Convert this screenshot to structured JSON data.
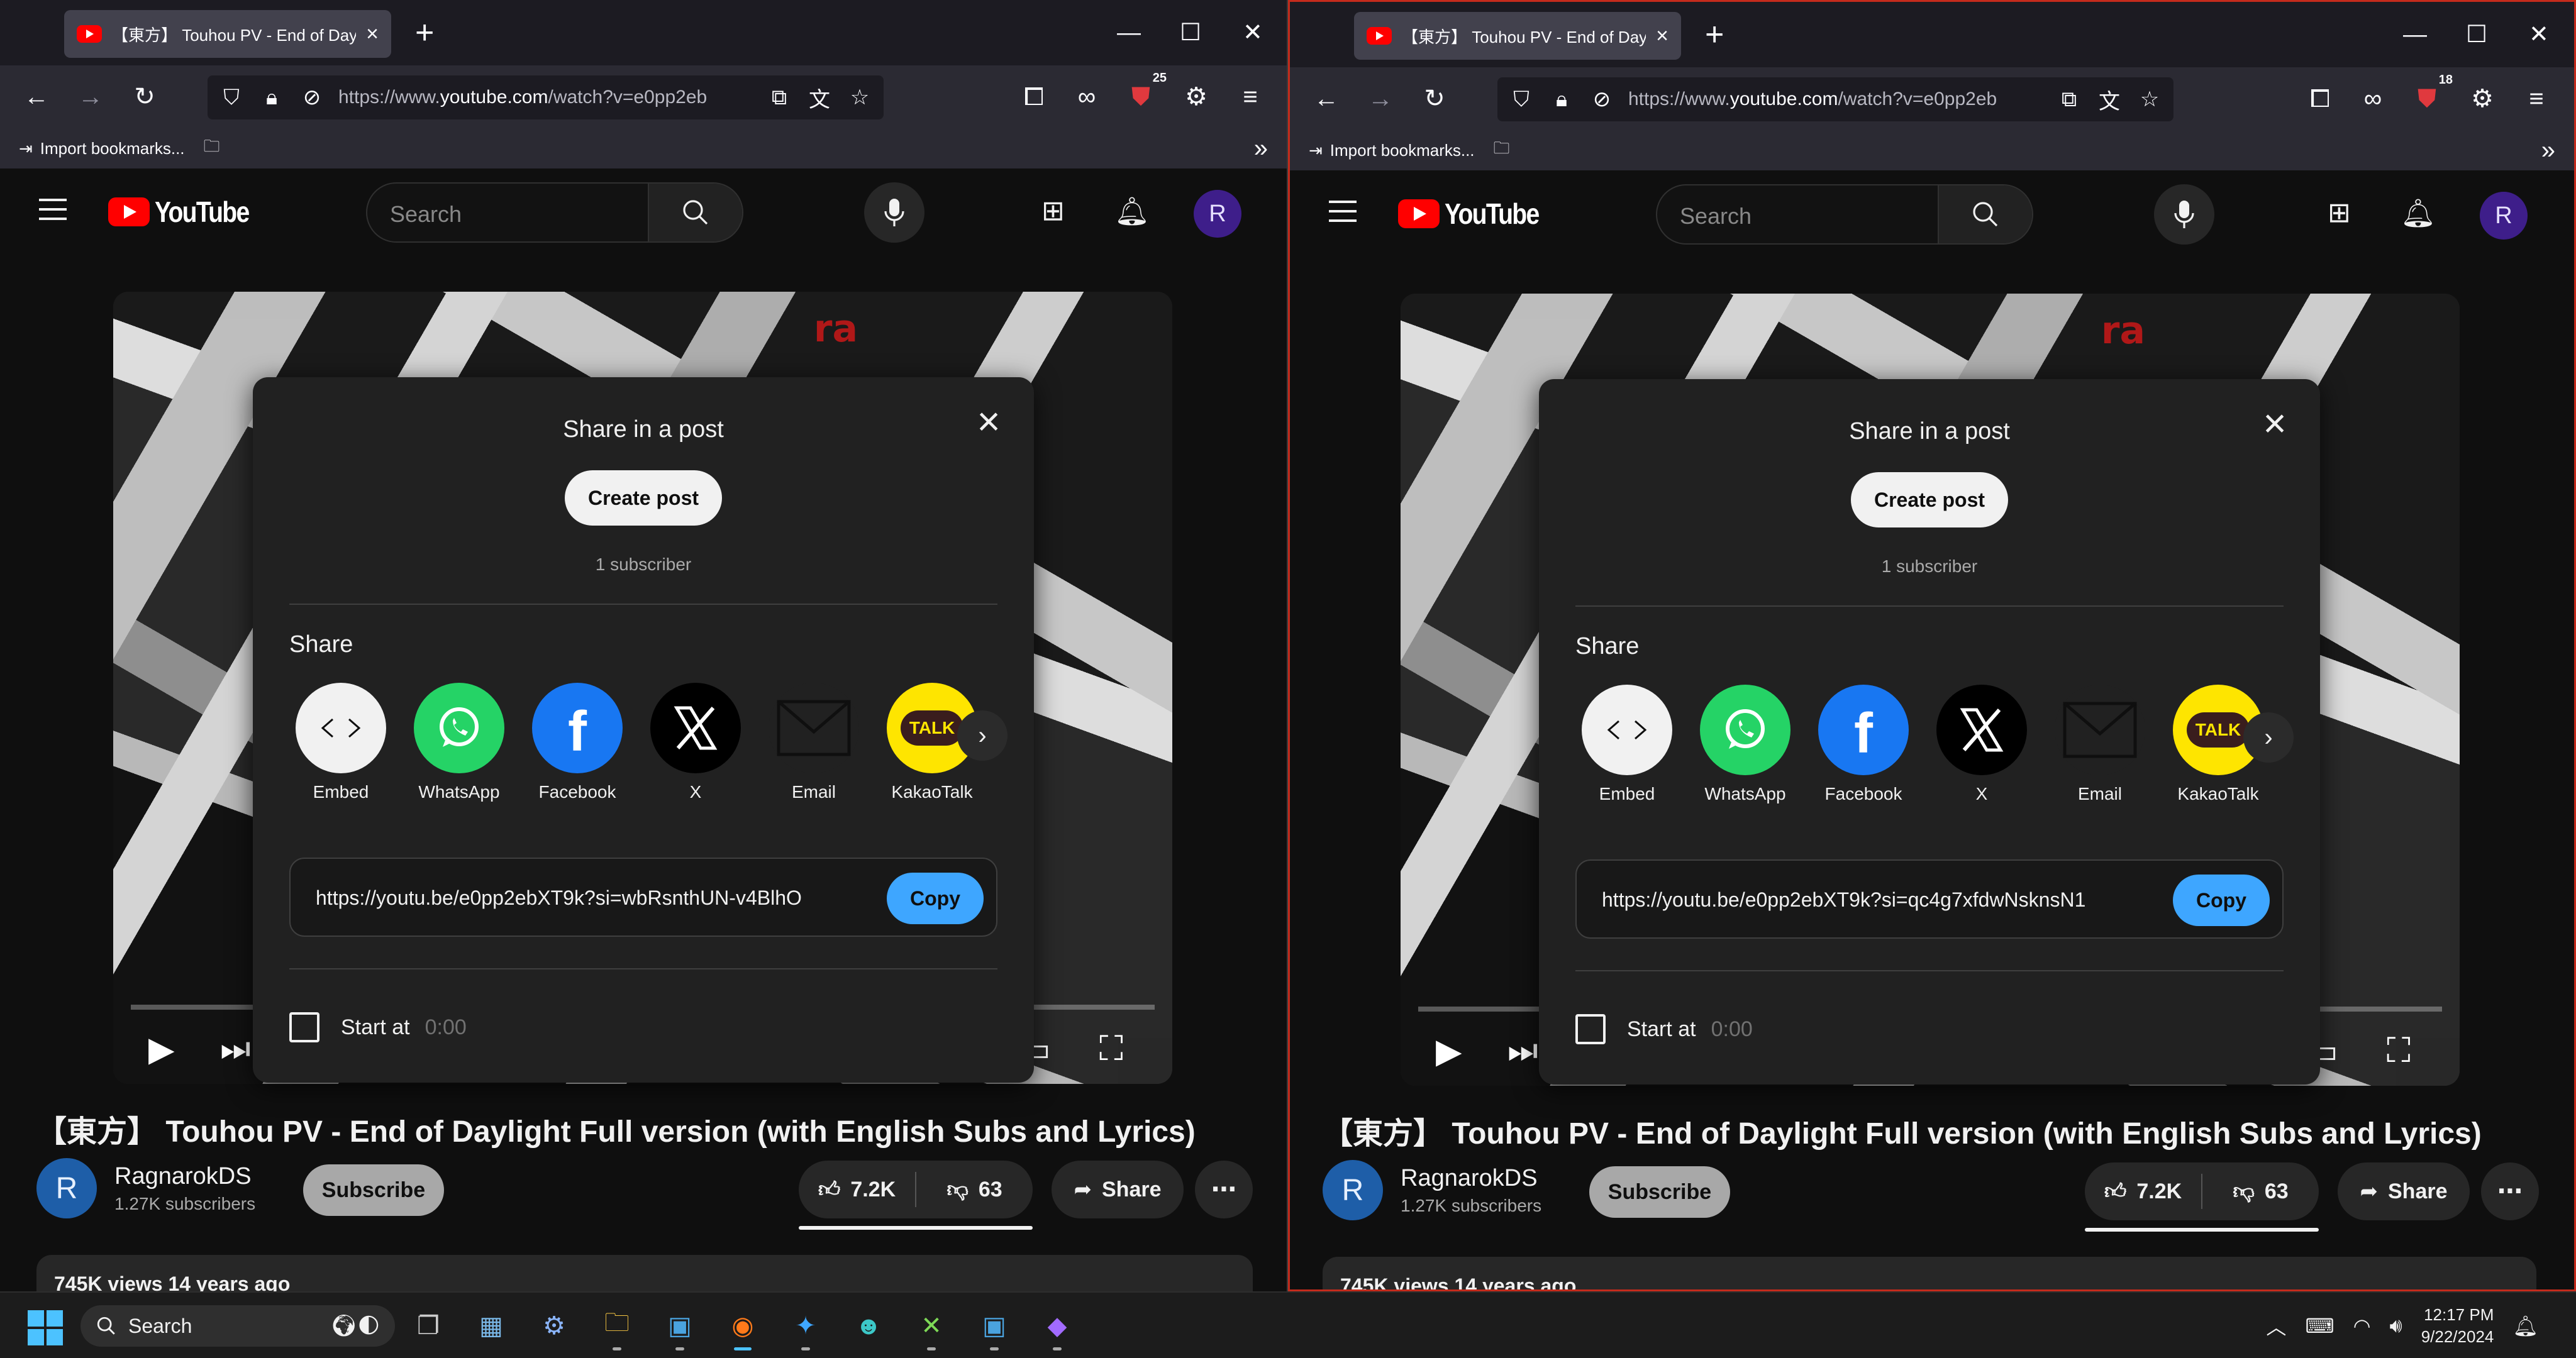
{
  "panes": [
    {
      "tab_title": "【東方】 Touhou PV - End of Daylig",
      "url_gray": "https://www.",
      "url_main": "youtube.com",
      "url_tail": "/watch?v=e0pp2eb",
      "ext_badge": "25",
      "share_link": "https://youtu.be/e0pp2ebXT9k?si=wbRsnthUN-v4BlhO"
    },
    {
      "tab_title": "【東方】 Touhou PV - End of Daylig",
      "url_gray": "https://www.",
      "url_main": "youtube.com",
      "url_tail": "/watch?v=e0pp2eb",
      "ext_badge": "18",
      "share_link": "https://youtu.be/e0pp2ebXT9k?si=qc4g7xfdwNsknsN1"
    }
  ],
  "browser": {
    "bookmark_import": "Import bookmarks...",
    "new_tab": "+"
  },
  "youtube": {
    "logo_text": "YouTube",
    "search_placeholder": "Search",
    "avatar_letter": "R",
    "video_overlay_text": "ra"
  },
  "dialog": {
    "title": "Share in a post",
    "create_post": "Create post",
    "subscriber_count": "1 subscriber",
    "share_heading": "Share",
    "apps": [
      {
        "label": "Embed",
        "icon": "embed-icon"
      },
      {
        "label": "WhatsApp",
        "icon": "whatsapp-icon"
      },
      {
        "label": "Facebook",
        "icon": "facebook-icon"
      },
      {
        "label": "X",
        "icon": "x-icon"
      },
      {
        "label": "Email",
        "icon": "email-icon"
      },
      {
        "label": "KakaoTalk",
        "icon": "kakaotalk-icon"
      }
    ],
    "copy_label": "Copy",
    "start_at_label": "Start at",
    "start_at_time": "0:00",
    "kakao_mark": "TALK"
  },
  "video": {
    "title": "【東方】 Touhou PV - End of Daylight Full version (with English Subs and Lyrics)",
    "channel_name": "RagnarokDS",
    "channel_initial": "R",
    "channel_subs": "1.27K subscribers",
    "subscribe_label": "Subscribe",
    "likes": "7.2K",
    "dislikes": "63",
    "share_label": "Share",
    "views_partial": "745K views  14 years ago"
  },
  "taskbar": {
    "search_label": "Search",
    "time": "12:17 PM",
    "date": "9/22/2024"
  },
  "colors": {
    "accent_blue": "#3ea6ff",
    "youtube_red": "#ff0000",
    "whatsapp": "#25d366",
    "facebook": "#1877f2",
    "kakao": "#fee500",
    "focus_border": "#c42b1c"
  }
}
